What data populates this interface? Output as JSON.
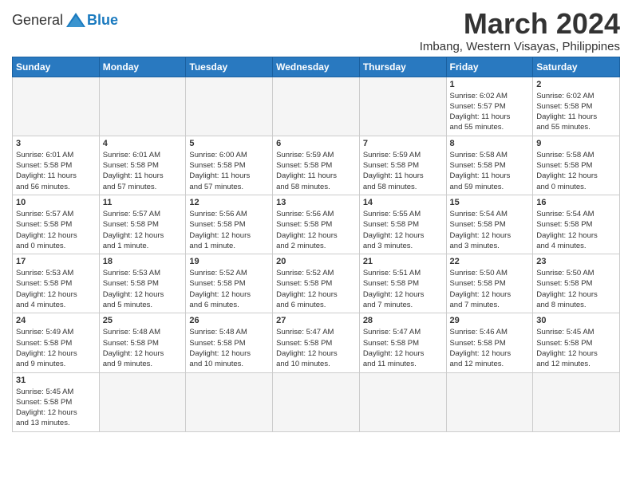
{
  "logo": {
    "general": "General",
    "blue": "Blue"
  },
  "header": {
    "month": "March 2024",
    "location": "Imbang, Western Visayas, Philippines"
  },
  "weekdays": [
    "Sunday",
    "Monday",
    "Tuesday",
    "Wednesday",
    "Thursday",
    "Friday",
    "Saturday"
  ],
  "weeks": [
    [
      {
        "day": "",
        "info": ""
      },
      {
        "day": "",
        "info": ""
      },
      {
        "day": "",
        "info": ""
      },
      {
        "day": "",
        "info": ""
      },
      {
        "day": "",
        "info": ""
      },
      {
        "day": "1",
        "info": "Sunrise: 6:02 AM\nSunset: 5:57 PM\nDaylight: 11 hours\nand 55 minutes."
      },
      {
        "day": "2",
        "info": "Sunrise: 6:02 AM\nSunset: 5:58 PM\nDaylight: 11 hours\nand 55 minutes."
      }
    ],
    [
      {
        "day": "3",
        "info": "Sunrise: 6:01 AM\nSunset: 5:58 PM\nDaylight: 11 hours\nand 56 minutes."
      },
      {
        "day": "4",
        "info": "Sunrise: 6:01 AM\nSunset: 5:58 PM\nDaylight: 11 hours\nand 57 minutes."
      },
      {
        "day": "5",
        "info": "Sunrise: 6:00 AM\nSunset: 5:58 PM\nDaylight: 11 hours\nand 57 minutes."
      },
      {
        "day": "6",
        "info": "Sunrise: 5:59 AM\nSunset: 5:58 PM\nDaylight: 11 hours\nand 58 minutes."
      },
      {
        "day": "7",
        "info": "Sunrise: 5:59 AM\nSunset: 5:58 PM\nDaylight: 11 hours\nand 58 minutes."
      },
      {
        "day": "8",
        "info": "Sunrise: 5:58 AM\nSunset: 5:58 PM\nDaylight: 11 hours\nand 59 minutes."
      },
      {
        "day": "9",
        "info": "Sunrise: 5:58 AM\nSunset: 5:58 PM\nDaylight: 12 hours\nand 0 minutes."
      }
    ],
    [
      {
        "day": "10",
        "info": "Sunrise: 5:57 AM\nSunset: 5:58 PM\nDaylight: 12 hours\nand 0 minutes."
      },
      {
        "day": "11",
        "info": "Sunrise: 5:57 AM\nSunset: 5:58 PM\nDaylight: 12 hours\nand 1 minute."
      },
      {
        "day": "12",
        "info": "Sunrise: 5:56 AM\nSunset: 5:58 PM\nDaylight: 12 hours\nand 1 minute."
      },
      {
        "day": "13",
        "info": "Sunrise: 5:56 AM\nSunset: 5:58 PM\nDaylight: 12 hours\nand 2 minutes."
      },
      {
        "day": "14",
        "info": "Sunrise: 5:55 AM\nSunset: 5:58 PM\nDaylight: 12 hours\nand 3 minutes."
      },
      {
        "day": "15",
        "info": "Sunrise: 5:54 AM\nSunset: 5:58 PM\nDaylight: 12 hours\nand 3 minutes."
      },
      {
        "day": "16",
        "info": "Sunrise: 5:54 AM\nSunset: 5:58 PM\nDaylight: 12 hours\nand 4 minutes."
      }
    ],
    [
      {
        "day": "17",
        "info": "Sunrise: 5:53 AM\nSunset: 5:58 PM\nDaylight: 12 hours\nand 4 minutes."
      },
      {
        "day": "18",
        "info": "Sunrise: 5:53 AM\nSunset: 5:58 PM\nDaylight: 12 hours\nand 5 minutes."
      },
      {
        "day": "19",
        "info": "Sunrise: 5:52 AM\nSunset: 5:58 PM\nDaylight: 12 hours\nand 6 minutes."
      },
      {
        "day": "20",
        "info": "Sunrise: 5:52 AM\nSunset: 5:58 PM\nDaylight: 12 hours\nand 6 minutes."
      },
      {
        "day": "21",
        "info": "Sunrise: 5:51 AM\nSunset: 5:58 PM\nDaylight: 12 hours\nand 7 minutes."
      },
      {
        "day": "22",
        "info": "Sunrise: 5:50 AM\nSunset: 5:58 PM\nDaylight: 12 hours\nand 7 minutes."
      },
      {
        "day": "23",
        "info": "Sunrise: 5:50 AM\nSunset: 5:58 PM\nDaylight: 12 hours\nand 8 minutes."
      }
    ],
    [
      {
        "day": "24",
        "info": "Sunrise: 5:49 AM\nSunset: 5:58 PM\nDaylight: 12 hours\nand 9 minutes."
      },
      {
        "day": "25",
        "info": "Sunrise: 5:48 AM\nSunset: 5:58 PM\nDaylight: 12 hours\nand 9 minutes."
      },
      {
        "day": "26",
        "info": "Sunrise: 5:48 AM\nSunset: 5:58 PM\nDaylight: 12 hours\nand 10 minutes."
      },
      {
        "day": "27",
        "info": "Sunrise: 5:47 AM\nSunset: 5:58 PM\nDaylight: 12 hours\nand 10 minutes."
      },
      {
        "day": "28",
        "info": "Sunrise: 5:47 AM\nSunset: 5:58 PM\nDaylight: 12 hours\nand 11 minutes."
      },
      {
        "day": "29",
        "info": "Sunrise: 5:46 AM\nSunset: 5:58 PM\nDaylight: 12 hours\nand 12 minutes."
      },
      {
        "day": "30",
        "info": "Sunrise: 5:45 AM\nSunset: 5:58 PM\nDaylight: 12 hours\nand 12 minutes."
      }
    ],
    [
      {
        "day": "31",
        "info": "Sunrise: 5:45 AM\nSunset: 5:58 PM\nDaylight: 12 hours\nand 13 minutes."
      },
      {
        "day": "",
        "info": ""
      },
      {
        "day": "",
        "info": ""
      },
      {
        "day": "",
        "info": ""
      },
      {
        "day": "",
        "info": ""
      },
      {
        "day": "",
        "info": ""
      },
      {
        "day": "",
        "info": ""
      }
    ]
  ]
}
